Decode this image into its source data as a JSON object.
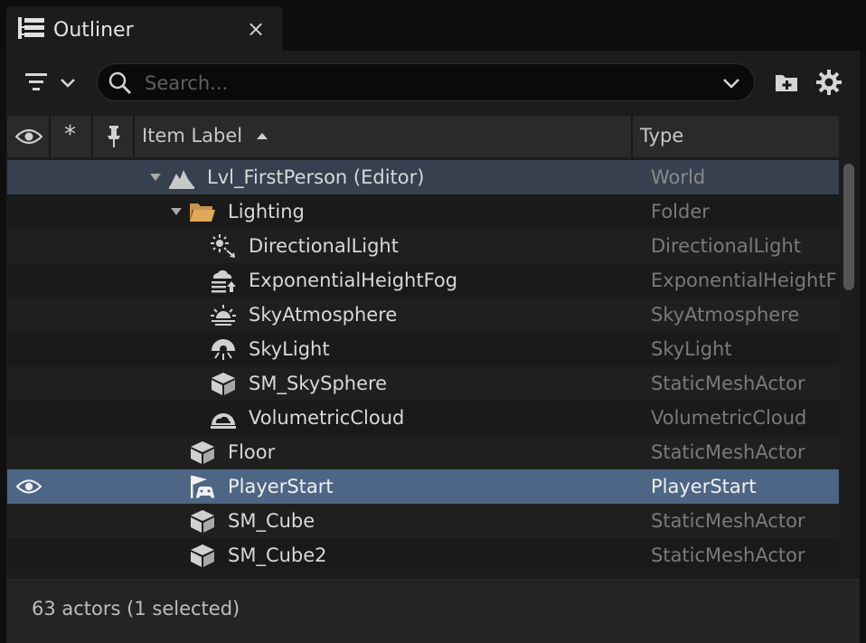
{
  "tab": {
    "title": "Outliner",
    "close_glyph": "×",
    "icon": "outliner-icon"
  },
  "toolbar": {
    "filter_icon": "filter-icon",
    "search_placeholder": "Search...",
    "search_value": "",
    "add_folder_icon": "add-folder-icon",
    "settings_icon": "settings-gear-icon"
  },
  "columns": {
    "visibility_icon": "eye-icon",
    "favorite_glyph": "*",
    "pin_icon": "pin-icon",
    "item_label": "Item Label",
    "sort": "ascending",
    "type": "Type"
  },
  "rows": [
    {
      "label": "Lvl_FirstPerson (Editor)",
      "type": "World",
      "icon": "world-icon",
      "depth": 0,
      "expanded": true,
      "visible": false,
      "selected": false
    },
    {
      "label": "Lighting",
      "type": "Folder",
      "icon": "folder-icon",
      "depth": 1,
      "expanded": true,
      "visible": false,
      "selected": false
    },
    {
      "label": "DirectionalLight",
      "type": "DirectionalLight",
      "icon": "directional-light-icon",
      "depth": 2,
      "visible": false,
      "selected": false
    },
    {
      "label": "ExponentialHeightFog",
      "type": "ExponentialHeightF",
      "icon": "height-fog-icon",
      "depth": 2,
      "visible": false,
      "selected": false
    },
    {
      "label": "SkyAtmosphere",
      "type": "SkyAtmosphere",
      "icon": "sky-atmosphere-icon",
      "depth": 2,
      "visible": false,
      "selected": false
    },
    {
      "label": "SkyLight",
      "type": "SkyLight",
      "icon": "sky-light-icon",
      "depth": 2,
      "visible": false,
      "selected": false
    },
    {
      "label": "SM_SkySphere",
      "type": "StaticMeshActor",
      "icon": "static-mesh-icon",
      "depth": 2,
      "visible": false,
      "selected": false
    },
    {
      "label": "VolumetricCloud",
      "type": "VolumetricCloud",
      "icon": "volumetric-cloud-icon",
      "depth": 2,
      "visible": false,
      "selected": false
    },
    {
      "label": "Floor",
      "type": "StaticMeshActor",
      "icon": "static-mesh-icon",
      "depth": 1,
      "visible": false,
      "selected": false
    },
    {
      "label": "PlayerStart",
      "type": "PlayerStart",
      "icon": "player-start-icon",
      "depth": 1,
      "visible": true,
      "selected": true
    },
    {
      "label": "SM_Cube",
      "type": "StaticMeshActor",
      "icon": "static-mesh-icon",
      "depth": 1,
      "visible": false,
      "selected": false
    },
    {
      "label": "SM_Cube2",
      "type": "StaticMeshActor",
      "icon": "static-mesh-icon",
      "depth": 1,
      "visible": false,
      "selected": false
    }
  ],
  "status": {
    "text": "63 actors (1 selected)"
  },
  "colors": {
    "selected_row": "#4e6685",
    "world_row": "#36404f",
    "folder": "#e0a95a",
    "panel": "#1c1c1c"
  }
}
